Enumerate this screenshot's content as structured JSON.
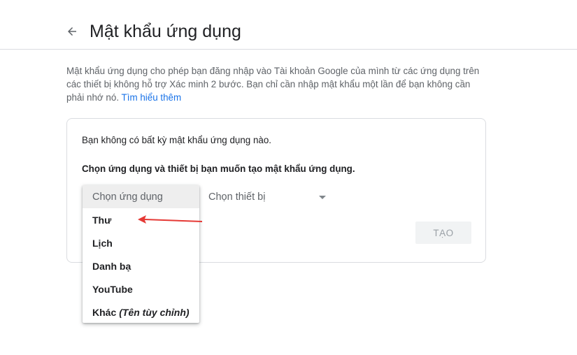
{
  "header": {
    "title": "Mật khẩu ứng dụng",
    "back_icon": "arrow-left-icon"
  },
  "description": {
    "text": "Mật khẩu ứng dụng cho phép bạn đăng nhập vào Tài khoản Google của mình từ các ứng dụng trên các thiết bị không hỗ trợ Xác minh 2 bước. Bạn chỉ cần nhập mật khẩu một lần để bạn không cần phải nhớ nó.",
    "learn_more": "Tìm hiểu thêm"
  },
  "card": {
    "no_passwords": "Bạn không có bất kỳ mật khẩu ứng dụng nào.",
    "instruction": "Chọn ứng dụng và thiết bị bạn muốn tạo mật khẩu ứng dụng.",
    "app_select": {
      "placeholder": "Chọn ứng dụng",
      "options": [
        {
          "label": "Thư",
          "hint": ""
        },
        {
          "label": "Lịch",
          "hint": ""
        },
        {
          "label": "Danh bạ",
          "hint": ""
        },
        {
          "label": "YouTube",
          "hint": ""
        },
        {
          "label": "Khác",
          "hint": "(Tên tùy chỉnh)"
        }
      ]
    },
    "device_select": {
      "placeholder": "Chọn thiết bị"
    },
    "create_button": "TẠO"
  },
  "colors": {
    "accent_link": "#1a73e8",
    "annotation_arrow": "#e53935",
    "disabled_button_bg": "#f1f3f4"
  }
}
